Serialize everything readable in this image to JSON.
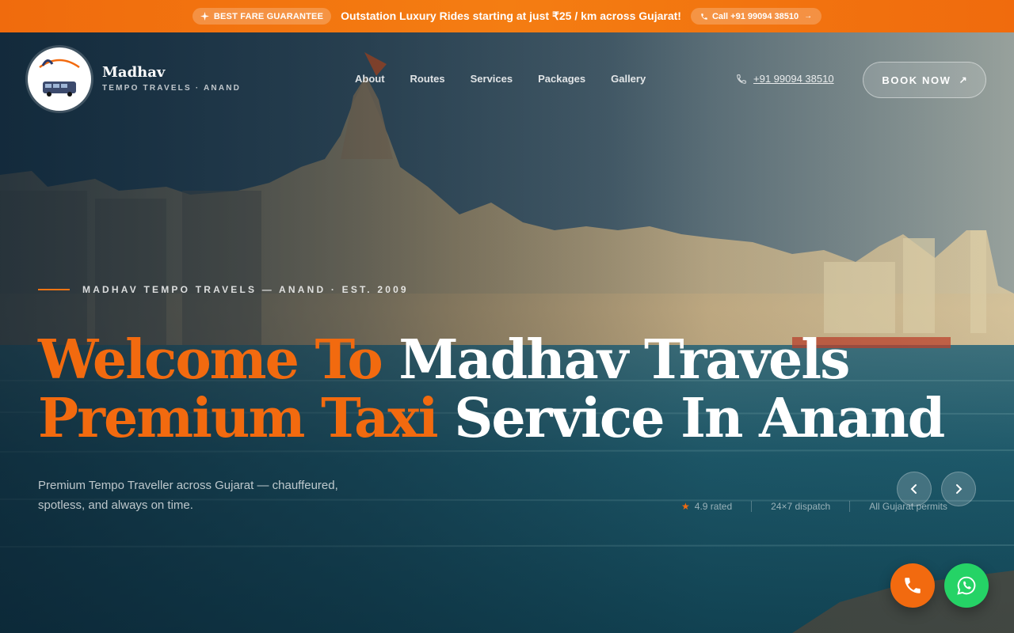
{
  "promo": {
    "badge": "BEST FARE GUARANTEE",
    "message": "Outstation Luxury Rides starting at just ₹25 / km across Gujarat!",
    "call_label": "Call +91 99094 38510",
    "call_arrow": "→"
  },
  "brand": {
    "name": "Madhav",
    "subtitle": "TEMPO TRAVELS · ANAND",
    "logo_text": "Madhav"
  },
  "nav": {
    "items": [
      "About",
      "Routes",
      "Services",
      "Packages",
      "Gallery"
    ]
  },
  "header": {
    "phone": "+91 99094 38510",
    "book_label": "BOOK NOW",
    "book_arrow": "↗"
  },
  "hero": {
    "eyebrow": "MADHAV TEMPO TRAVELS — ANAND · EST. 2009",
    "headline_line1_orange": "Welcome To ",
    "headline_line1_white": "Madhav Travels",
    "headline_line2_orange": "Premium Taxi ",
    "headline_line2_white": "Service In Anand",
    "subtext": "Premium Tempo Traveller across Gujarat — chauffeured, spotless, and always on time.",
    "stats": [
      "4.9 rated",
      "24×7 dispatch",
      "All Gujarat permits"
    ]
  },
  "icons": {
    "promo_badge": "sparkle-icon",
    "promo_call": "phone-icon",
    "header_phone": "phone-icon",
    "rating": "star-icon",
    "prev": "chevron-left-icon",
    "next": "chevron-right-icon",
    "fab_call": "phone-icon",
    "fab_whatsapp": "whatsapp-icon"
  },
  "colors": {
    "accent": "#f26a0f",
    "promo_bar": "#f47413",
    "whatsapp": "#25d366"
  }
}
